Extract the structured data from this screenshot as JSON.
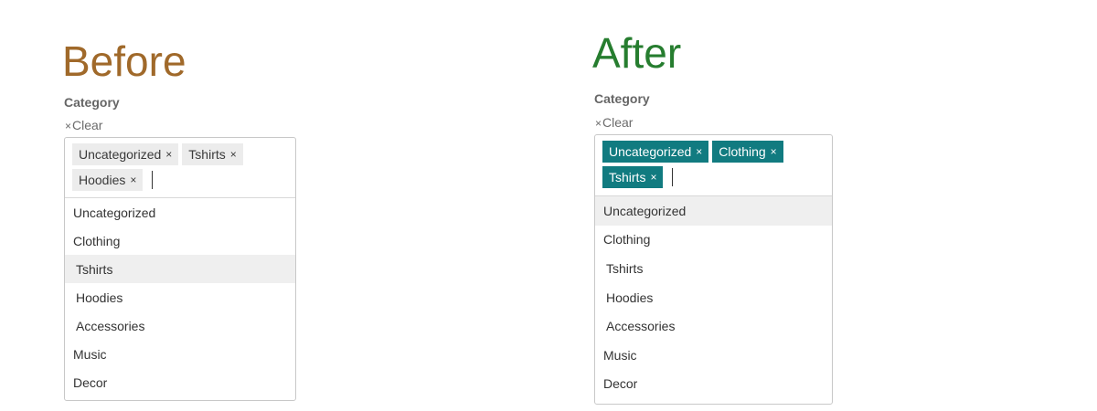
{
  "before": {
    "heading": "Before",
    "label": "Category",
    "clear_icon": "×",
    "clear_label": "Clear",
    "selected": [
      {
        "label": "Uncategorized",
        "remove": "×"
      },
      {
        "label": "Tshirts",
        "remove": "×"
      },
      {
        "label": "Hoodies",
        "remove": "×"
      }
    ],
    "options": [
      {
        "label": "Uncategorized",
        "child": false,
        "highlighted": false
      },
      {
        "label": "Clothing",
        "child": false,
        "highlighted": false
      },
      {
        "label": "Tshirts",
        "child": true,
        "highlighted": true
      },
      {
        "label": "Hoodies",
        "child": true,
        "highlighted": false
      },
      {
        "label": "Accessories",
        "child": true,
        "highlighted": false
      },
      {
        "label": "Music",
        "child": false,
        "highlighted": false
      },
      {
        "label": "Decor",
        "child": false,
        "highlighted": false
      }
    ]
  },
  "after": {
    "heading": "After",
    "label": "Category",
    "clear_icon": "×",
    "clear_label": "Clear",
    "selected": [
      {
        "label": "Uncategorized",
        "remove": "×"
      },
      {
        "label": "Clothing",
        "remove": "×"
      },
      {
        "label": "Tshirts",
        "remove": "×"
      }
    ],
    "options": [
      {
        "label": "Uncategorized",
        "child": false,
        "highlighted": true
      },
      {
        "label": "Clothing",
        "child": false,
        "highlighted": false
      },
      {
        "label": "Tshirts",
        "child": true,
        "highlighted": false
      },
      {
        "label": "Hoodies",
        "child": true,
        "highlighted": false
      },
      {
        "label": "Accessories",
        "child": true,
        "highlighted": false
      },
      {
        "label": "Music",
        "child": false,
        "highlighted": false
      },
      {
        "label": "Decor",
        "child": false,
        "highlighted": false
      }
    ]
  },
  "colors": {
    "before_heading": "#a0692a",
    "after_heading": "#267d2f",
    "before_token_bg": "#ececec",
    "after_token_bg": "#117b80"
  }
}
